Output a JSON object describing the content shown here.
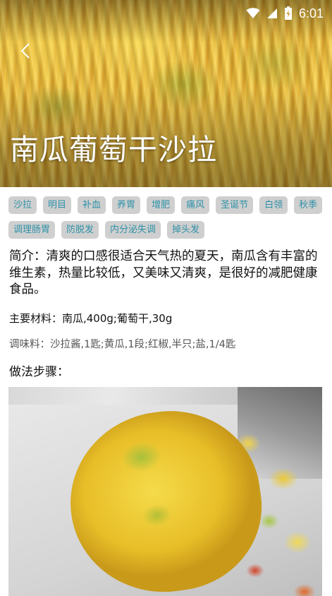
{
  "status_bar": {
    "time": "6:01",
    "icons": [
      "wifi-icon",
      "cell-signal-icon",
      "battery-icon"
    ]
  },
  "header": {
    "back_icon": "chevron-left-icon",
    "title": "南瓜葡萄干沙拉"
  },
  "tags": [
    "沙拉",
    "明目",
    "补血",
    "养胃",
    "增肥",
    "痛风",
    "圣诞节",
    "白领",
    "秋季",
    "调理肠胃",
    "防脱发",
    "内分泌失调",
    "掉头发"
  ],
  "intro": "简介：清爽的口感很适合天气热的夏天，南瓜含有丰富的维生素，热量比较低，又美味又清爽，是很好的减肥健康食品。",
  "materials": "主要材料：南瓜,400g;葡萄干,30g",
  "seasoning": "调味料：沙拉酱,1匙;黄瓜,1段;红椒,半只;盐,1/4匙",
  "steps_heading": "做法步骤：",
  "colors": {
    "tag_background": "#cfcfcf",
    "tag_text": "#2f92a8",
    "title_text": "#ffffff"
  }
}
